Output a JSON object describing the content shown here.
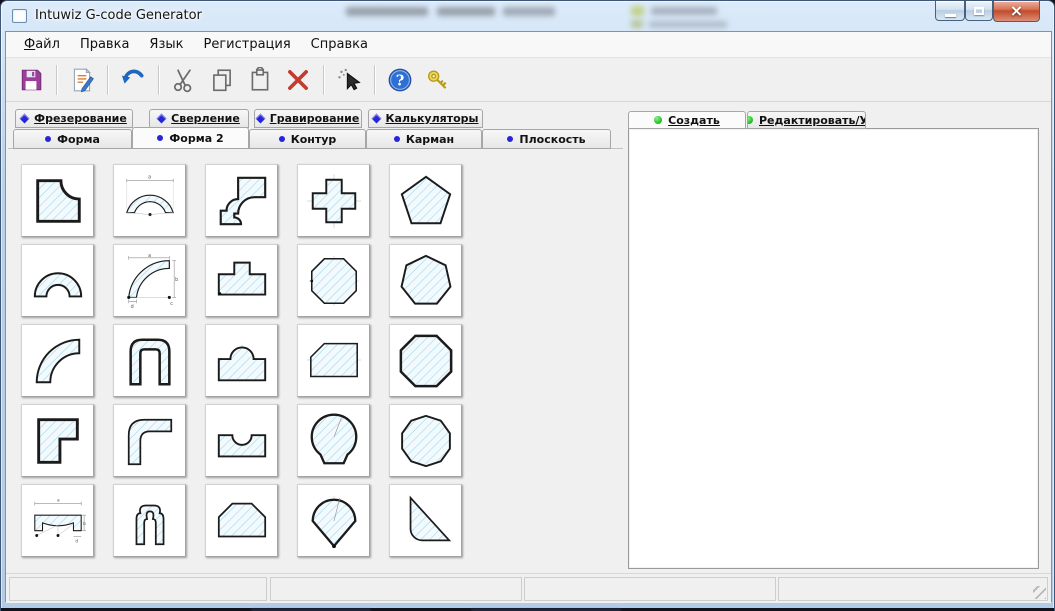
{
  "window": {
    "title": "Intuwiz G-code Generator",
    "controls": [
      {
        "name": "minimize"
      },
      {
        "name": "maximize"
      },
      {
        "name": "close"
      }
    ]
  },
  "menu_bar": {
    "items": [
      {
        "name": "file",
        "label": "Файл",
        "underline_first": true
      },
      {
        "name": "edit",
        "label": "Правка"
      },
      {
        "name": "language",
        "label": "Язык"
      },
      {
        "name": "registration",
        "label": "Регистрация"
      },
      {
        "name": "help",
        "label": "Справка"
      }
    ]
  },
  "toolbar": {
    "buttons": [
      {
        "name": "save",
        "icon": "floppy-disk-icon"
      },
      {
        "name": "edit-document",
        "icon": "edit-document-icon"
      },
      {
        "name": "undo",
        "icon": "undo-arrow-icon"
      },
      {
        "name": "cut",
        "icon": "scissors-icon"
      },
      {
        "name": "copy",
        "icon": "copy-pages-icon"
      },
      {
        "name": "paste",
        "icon": "clipboard-icon"
      },
      {
        "name": "delete",
        "icon": "delete-x-icon"
      },
      {
        "name": "select-tool",
        "icon": "magic-pointer-icon"
      },
      {
        "name": "help",
        "icon": "help-circle-icon"
      },
      {
        "name": "license-key",
        "icon": "key-icon"
      }
    ],
    "separators_after": [
      "save",
      "edit-document",
      "undo",
      "delete",
      "select-tool"
    ]
  },
  "operation_tabs": [
    {
      "name": "frezerovanie",
      "label": "Фрезерование"
    },
    {
      "name": "sverlenie",
      "label": "Сверление"
    },
    {
      "name": "gravirovanie",
      "label": "Гравирование"
    },
    {
      "name": "kalkulyatory",
      "label": "Калькуляторы"
    }
  ],
  "shape_tabs": [
    {
      "name": "forma",
      "label": "Форма"
    },
    {
      "name": "forma-2",
      "label": "Форма 2",
      "active": true
    },
    {
      "name": "kontur",
      "label": "Контур"
    },
    {
      "name": "karman",
      "label": "Карман"
    },
    {
      "name": "ploskost",
      "label": "Плоскость"
    }
  ],
  "right_tabs": [
    {
      "name": "sozdat",
      "label": "Создать",
      "active": true
    },
    {
      "name": "redaktirovat",
      "label": "Редактировать/У"
    }
  ],
  "shape_gallery": [
    {
      "name": "rect-concave-corner"
    },
    {
      "name": "arch-bridge"
    },
    {
      "name": "stepped-corner"
    },
    {
      "name": "cross-plus"
    },
    {
      "name": "pentagon"
    },
    {
      "name": "half-ring"
    },
    {
      "name": "curved-wedge"
    },
    {
      "name": "t-shape"
    },
    {
      "name": "octagon-crosshair"
    },
    {
      "name": "heptagon"
    },
    {
      "name": "quarter-ring-blade"
    },
    {
      "name": "u-channel"
    },
    {
      "name": "rect-dome-top"
    },
    {
      "name": "rect-chamfer-corner"
    },
    {
      "name": "octagon"
    },
    {
      "name": "l-block"
    },
    {
      "name": "elbow-bend"
    },
    {
      "name": "rect-semicircle-notch"
    },
    {
      "name": "balloon-flat-bottom"
    },
    {
      "name": "decagon"
    },
    {
      "name": "lintel-arch"
    },
    {
      "name": "portal-arch"
    },
    {
      "name": "flat-hexagon"
    },
    {
      "name": "fan-point-bottom"
    },
    {
      "name": "right-triangle-fillet"
    }
  ],
  "status_bar": {
    "panels": [
      "",
      "",
      "",
      ""
    ]
  },
  "colors": {
    "accent_blue": "#2626d8",
    "accent_green": "#28c32c",
    "hatch_blue": "#96d2e8",
    "shape_outline": "#1b1b1b",
    "close_red": "#c24b2c",
    "save_purple": "#9c3f9c"
  }
}
